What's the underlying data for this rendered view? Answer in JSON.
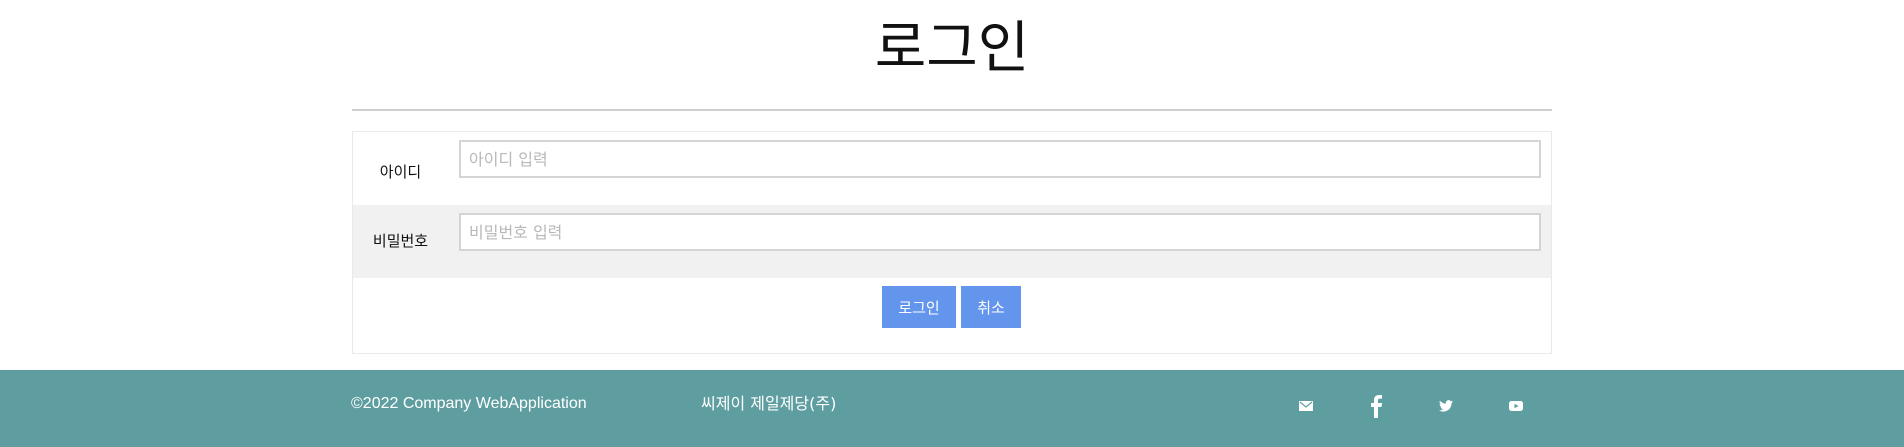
{
  "page": {
    "title": "로그인"
  },
  "form": {
    "id_label": "아이디",
    "id_placeholder": "아이디 입력",
    "id_value": "",
    "pw_label": "비밀번호",
    "pw_placeholder": "비밀번호 입력",
    "pw_value": "",
    "login_button": "로그인",
    "cancel_button": "취소"
  },
  "footer": {
    "copyright": "©2022 Company WebApplication",
    "company": "씨제이 제일제당(주)",
    "social_icons": [
      "mail-icon",
      "facebook-icon",
      "twitter-icon",
      "youtube-icon"
    ]
  },
  "colors": {
    "accent": "#6495ed",
    "footer_bg": "#5f9ea0",
    "row_alt_bg": "#f1f1f1"
  }
}
